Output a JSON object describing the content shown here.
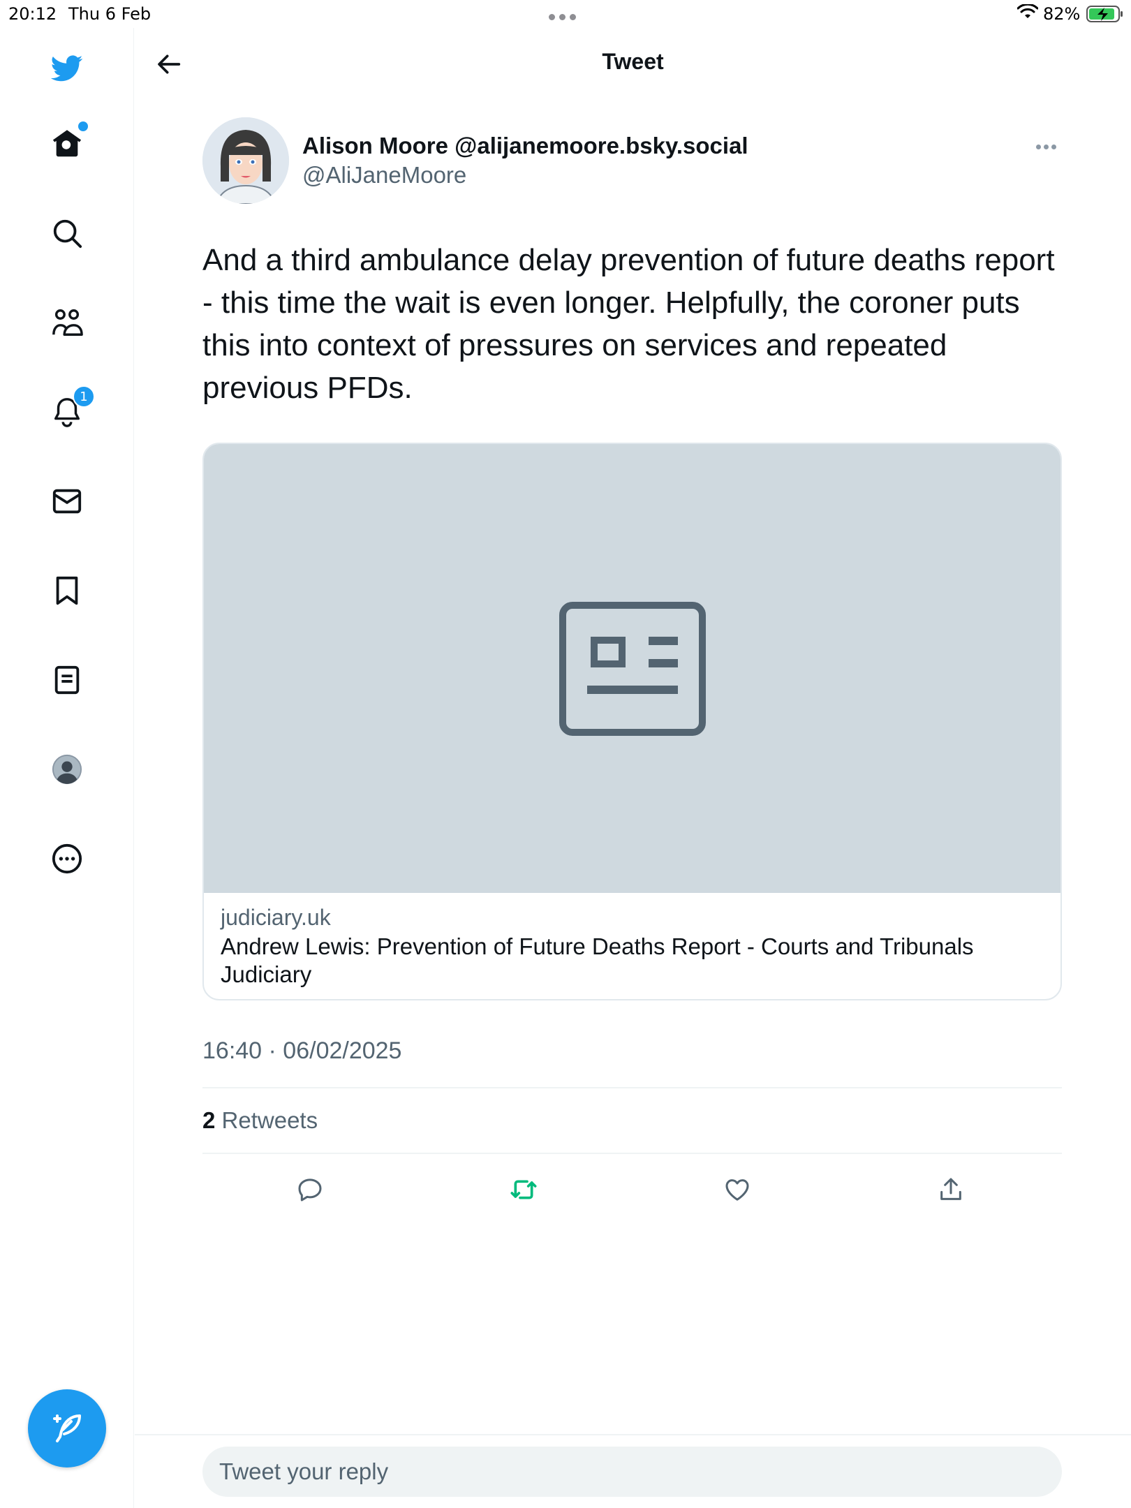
{
  "status_bar": {
    "time": "20:12",
    "date": "Thu 6 Feb",
    "battery_percent": "82%"
  },
  "header": {
    "title": "Tweet",
    "back_icon": "arrow-left-icon"
  },
  "sidebar": {
    "items": [
      {
        "name": "home",
        "icon": "home-icon",
        "has_dot": true
      },
      {
        "name": "explore",
        "icon": "search-icon"
      },
      {
        "name": "communities",
        "icon": "people-icon"
      },
      {
        "name": "notifications",
        "icon": "bell-icon",
        "badge": "1"
      },
      {
        "name": "messages",
        "icon": "mail-icon"
      },
      {
        "name": "bookmarks",
        "icon": "bookmark-icon"
      },
      {
        "name": "lists",
        "icon": "list-icon"
      },
      {
        "name": "profile",
        "icon": "profile-icon"
      },
      {
        "name": "more",
        "icon": "more-circle-icon"
      }
    ],
    "compose_icon": "compose-icon"
  },
  "tweet": {
    "author_name": "Alison Moore @alijanemoore.bsky.social",
    "author_handle": "@AliJaneMoore",
    "text": "And a third ambulance delay prevention of future deaths report - this time the wait is even longer. Helpfully, the coroner puts this into context of pressures on services and repeated previous PFDs.",
    "card": {
      "domain": "judiciary.uk",
      "title": "Andrew Lewis: Prevention of Future Deaths Report - Courts and Tribunals Judiciary"
    },
    "timestamp": "16:40 · 06/02/2025",
    "retweet_count": "2",
    "retweet_label": "Retweets"
  },
  "actions": [
    {
      "name": "reply",
      "icon": "reply-icon"
    },
    {
      "name": "retweet",
      "icon": "retweet-icon",
      "color": "#00ba7c"
    },
    {
      "name": "like",
      "icon": "heart-icon"
    },
    {
      "name": "share",
      "icon": "share-icon"
    }
  ],
  "reply_bar": {
    "placeholder": "Tweet your reply"
  },
  "colors": {
    "brand_blue": "#1d9bf0",
    "retweet_green": "#00ba7c",
    "secondary_text": "#536471",
    "card_placeholder": "#cfd9df"
  }
}
